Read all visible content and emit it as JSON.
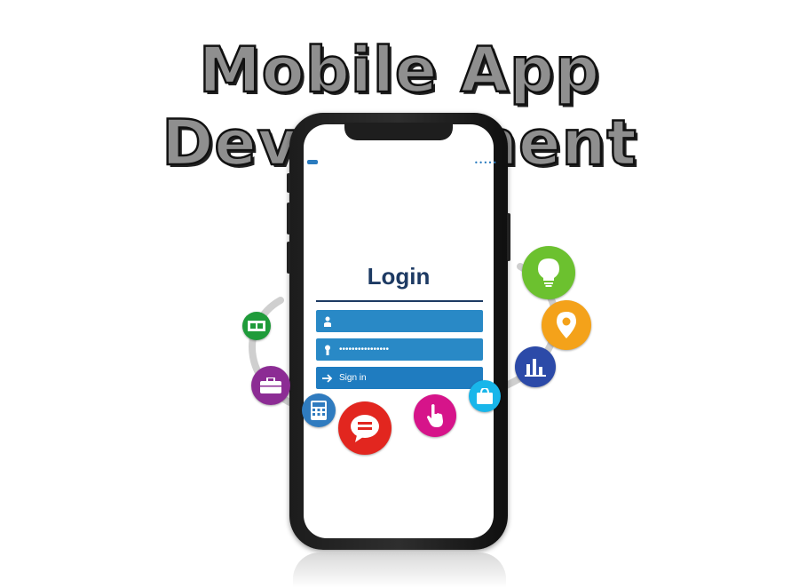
{
  "headline": "Mobile App Development",
  "screen": {
    "status_dots": "•••••",
    "login_title": "Login",
    "password_mask": "••••••••••••••••",
    "signin_label": "Sign in"
  },
  "colors": {
    "field_blue": "#2989c6",
    "login_text": "#1d3a63",
    "title_fill": "#8f8f8f",
    "bulb_green": "#6cc12f",
    "pin_orange": "#f4a21a",
    "chart_blue": "#2c4aa8",
    "bag_cyan": "#19b6ea",
    "hand_magenta": "#d6148a",
    "chat_red": "#e2261f",
    "calc_blue": "#2f7bbf",
    "briefcase_purple": "#8c2c94",
    "film_green": "#1f9b3a"
  },
  "icons": [
    "film-icon",
    "briefcase-icon",
    "calculator-icon",
    "chat-icon",
    "hand-pointer-icon",
    "shopping-bag-icon",
    "bar-chart-icon",
    "location-pin-icon",
    "lightbulb-icon"
  ]
}
